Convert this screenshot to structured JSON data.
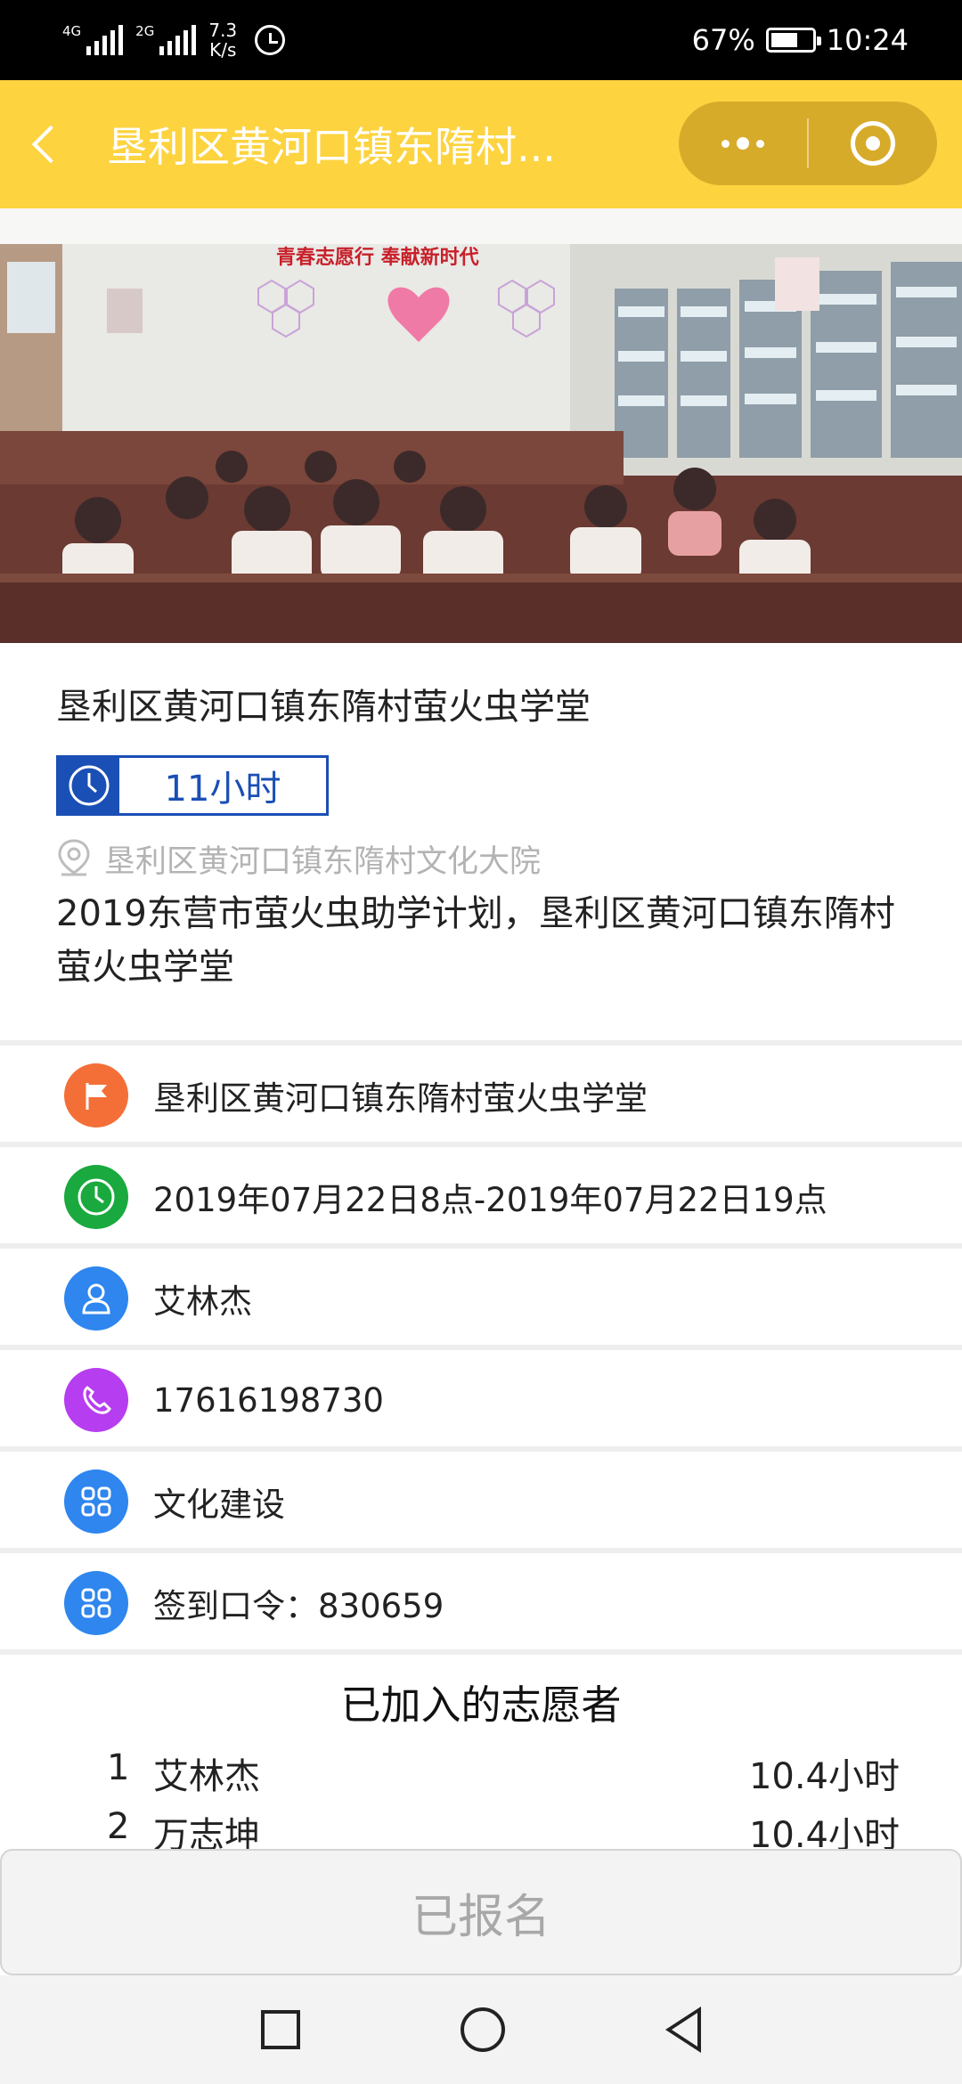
{
  "status_bar": {
    "network_1": "4G",
    "network_2": "2G",
    "speed_value": "7.3",
    "speed_unit": "K/s",
    "battery_percent": "67%",
    "battery_level": 0.67,
    "time": "10:24"
  },
  "header": {
    "title": "垦利区黄河口镇东隋村...",
    "accent_color": "#fdd33f"
  },
  "banner": {
    "wall_slogan": "青春志愿行 奉献新时代"
  },
  "project": {
    "title": "垦利区黄河口镇东隋村萤火虫学堂",
    "hours": "11小时",
    "location": "垦利区黄河口镇东隋村文化大院",
    "description": "2019东营市萤火虫助学计划，垦利区黄河口镇东隋村萤火虫学堂"
  },
  "details": [
    {
      "icon": "flag-icon",
      "color": "#f46f38",
      "text": "垦利区黄河口镇东隋村萤火虫学堂"
    },
    {
      "icon": "clock-icon",
      "color": "#1aa93e",
      "text": "2019年07月22日8点-2019年07月22日19点"
    },
    {
      "icon": "user-icon",
      "color": "#2e86ee",
      "text": "艾林杰"
    },
    {
      "icon": "phone-icon",
      "color": "#b73df0",
      "text": "17616198730"
    },
    {
      "icon": "grid-icon",
      "color": "#2e86ee",
      "text": "文化建设"
    },
    {
      "icon": "grid-icon",
      "color": "#2e86ee",
      "text": "签到口令：830659"
    }
  ],
  "volunteers": {
    "title": "已加入的志愿者",
    "list": [
      {
        "no": "1",
        "name": "艾林杰",
        "hours": "10.4小时"
      },
      {
        "no": "2",
        "name": "万志坤",
        "hours": "10.4小时"
      }
    ]
  },
  "signup_button": {
    "label": "已报名"
  }
}
